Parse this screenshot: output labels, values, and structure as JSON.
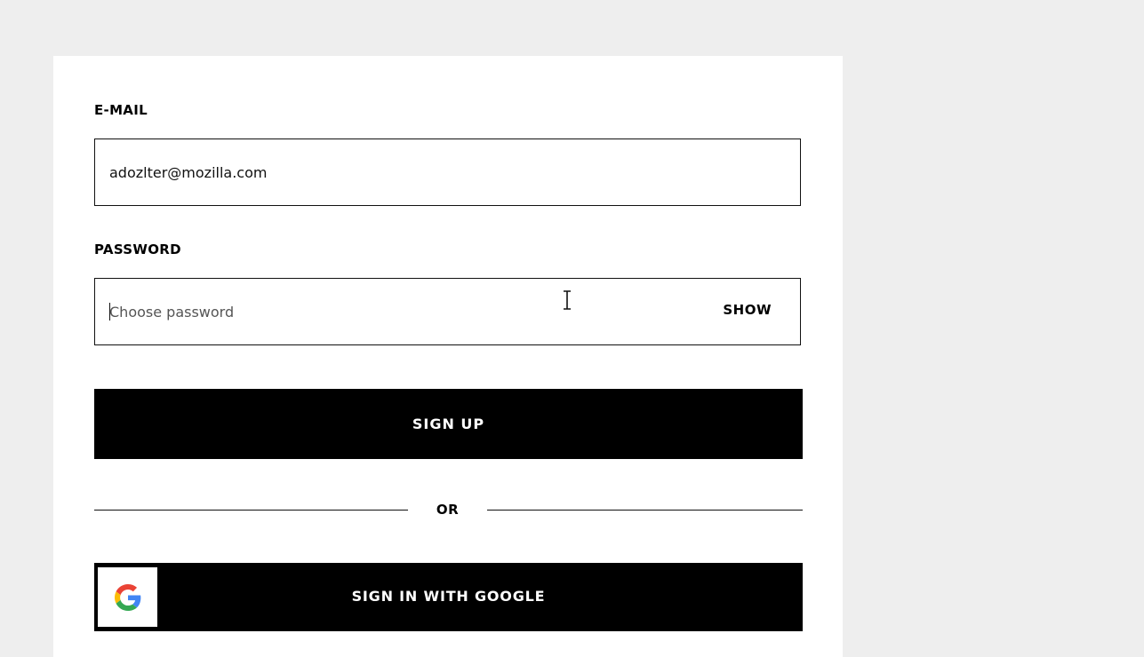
{
  "form": {
    "email_label": "E-MAIL",
    "email_value": "adozlter@mozilla.com",
    "password_label": "PASSWORD",
    "password_placeholder": "Choose password",
    "password_value": "",
    "show_label": "SHOW",
    "signup_label": "SIGN UP",
    "or_label": "OR",
    "google_label": "SIGN IN WITH GOOGLE"
  },
  "icons": {
    "google": "google-logo-icon",
    "cursor": "text-cursor-icon"
  },
  "colors": {
    "background": "#eeeeee",
    "card": "#ffffff",
    "primary": "#000000",
    "google_blue": "#4285F4",
    "google_red": "#EA4335",
    "google_yellow": "#FBBC05",
    "google_green": "#34A853"
  }
}
